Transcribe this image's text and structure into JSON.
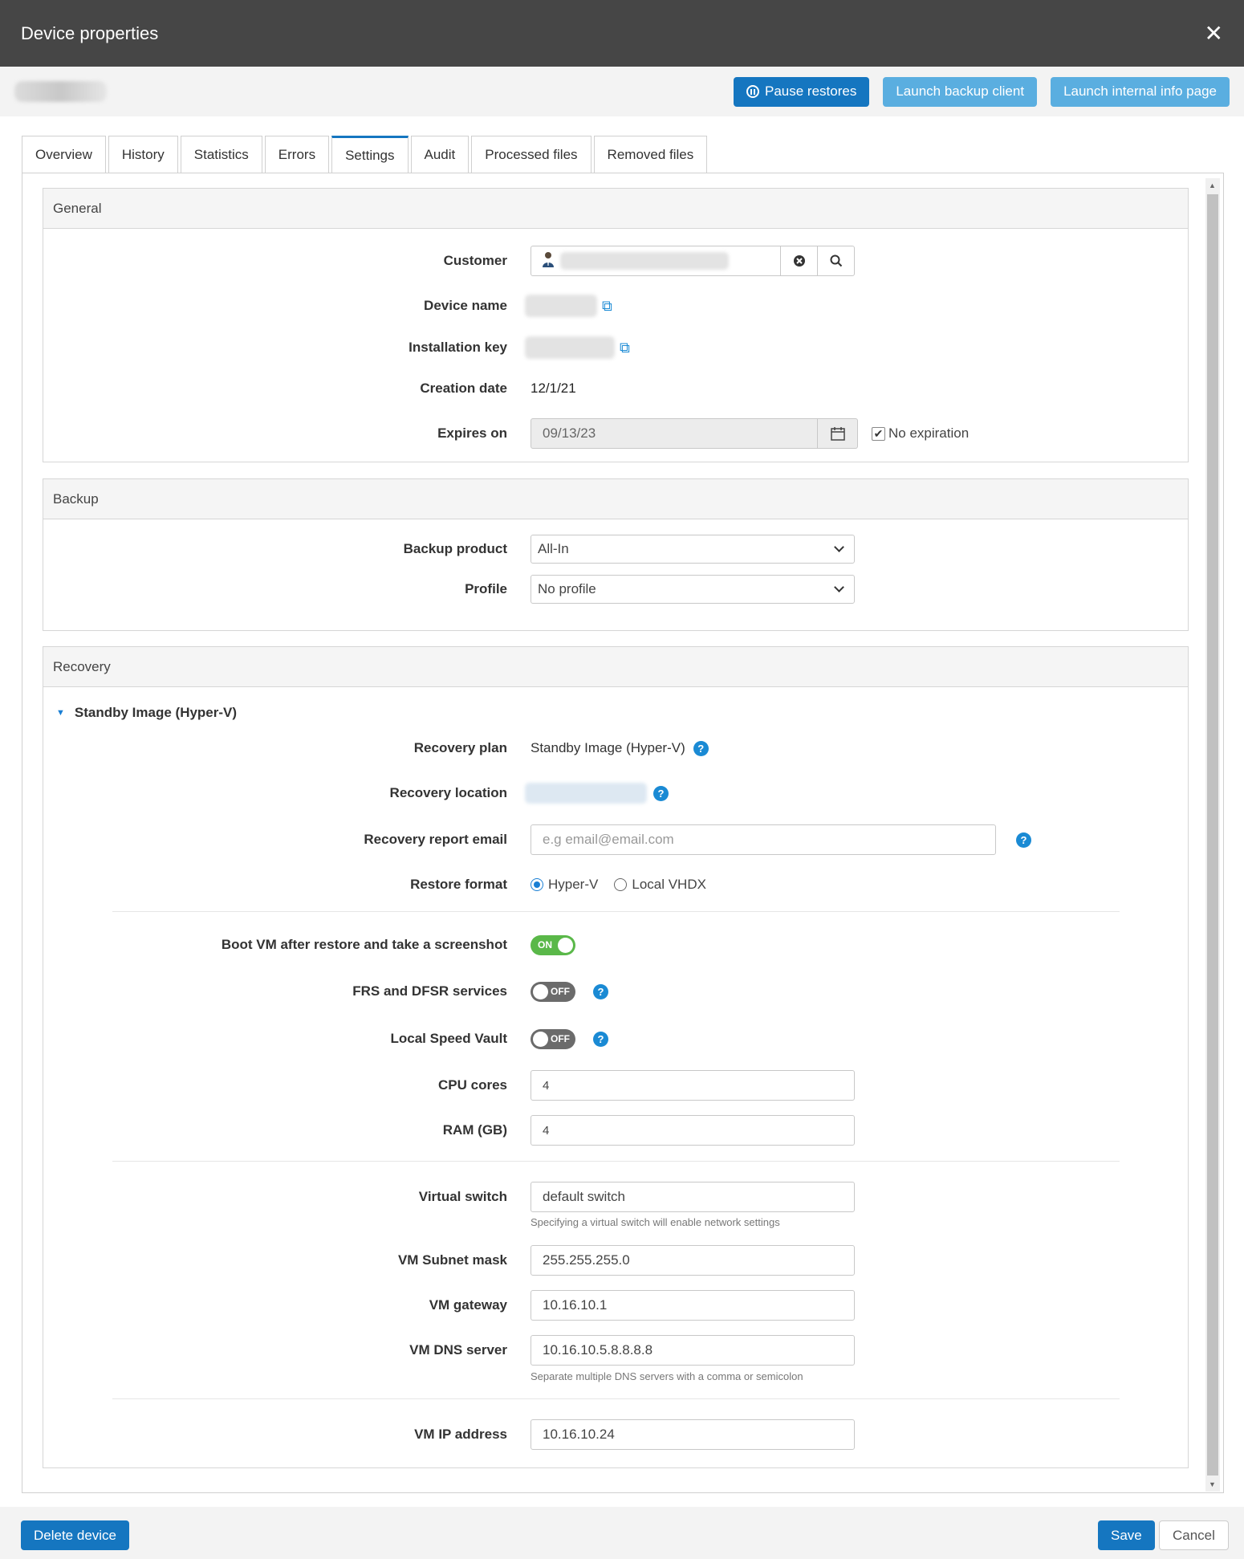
{
  "window": {
    "title": "Device properties"
  },
  "toolbar": {
    "pause_label": "Pause restores",
    "launch_client_label": "Launch backup client",
    "launch_info_label": "Launch internal info page"
  },
  "tabs": [
    {
      "label": "Overview"
    },
    {
      "label": "History"
    },
    {
      "label": "Statistics"
    },
    {
      "label": "Errors"
    },
    {
      "label": "Settings"
    },
    {
      "label": "Audit"
    },
    {
      "label": "Processed files"
    },
    {
      "label": "Removed files"
    }
  ],
  "active_tab": "Settings",
  "general": {
    "title": "General",
    "customer_label": "Customer",
    "device_name_label": "Device name",
    "installation_key_label": "Installation key",
    "creation_date_label": "Creation date",
    "creation_date": "12/1/21",
    "expires_label": "Expires on",
    "expires_value": "09/13/23",
    "no_expiration_label": "No expiration",
    "no_expiration_checked": true
  },
  "backup": {
    "title": "Backup",
    "product_label": "Backup product",
    "product_value": "All-In",
    "profile_label": "Profile",
    "profile_value": "No profile"
  },
  "recovery": {
    "title": "Recovery",
    "plan_header": "Standby Image (Hyper-V)",
    "plan_label": "Recovery plan",
    "plan_value": "Standby Image (Hyper-V)",
    "location_label": "Recovery location",
    "email_label": "Recovery report email",
    "email_placeholder": "e.g email@email.com",
    "restore_format_label": "Restore format",
    "restore_options": [
      "Hyper-V",
      "Local VHDX"
    ],
    "restore_selected": "Hyper-V",
    "boot_label": "Boot VM after restore and take a screenshot",
    "boot_state": "ON",
    "frs_label": "FRS and DFSR services",
    "frs_state": "OFF",
    "lsv_label": "Local Speed Vault",
    "lsv_state": "OFF",
    "cpu_label": "CPU cores",
    "cpu_value": "4",
    "ram_label": "RAM (GB)",
    "ram_value": "4",
    "switch_label": "Virtual switch",
    "switch_value": "default switch",
    "switch_hint": "Specifying a virtual switch will enable network settings",
    "subnet_label": "VM Subnet mask",
    "subnet_value": "255.255.255.0",
    "gateway_label": "VM gateway",
    "gateway_value": "10.16.10.1",
    "dns_label": "VM DNS server",
    "dns_value": "10.16.10.5.8.8.8.8",
    "dns_hint": "Separate multiple DNS servers with a comma or semicolon",
    "ip_label": "VM IP address",
    "ip_value": "10.16.10.24"
  },
  "footer": {
    "delete_label": "Delete device",
    "save_label": "Save",
    "cancel_label": "Cancel"
  },
  "colors": {
    "primary": "#1576c0",
    "light_primary": "#5aaee0",
    "toggle_on": "#5ab849",
    "titlebar": "#464646"
  }
}
